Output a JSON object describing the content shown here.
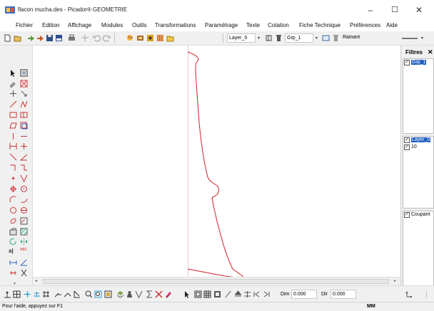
{
  "window": {
    "title": "flacon mucha.des - Picador® GEOMETRIE",
    "minimize": "–",
    "maximize": "☐",
    "close": "✕"
  },
  "menu": [
    "Fichier",
    "Edition",
    "Affichage",
    "Modules",
    "Outils",
    "Transformations",
    "Paramétrage",
    "Texte",
    "Cotation",
    "Fiche Technique",
    "Préférences",
    "Aide"
  ],
  "toolbar": {
    "layer_value": "Layer_0",
    "group_value": "Grp_1",
    "style_value": "Rainant",
    "dropdown_arrow": "▾"
  },
  "filters_panel": {
    "title": "Filtres",
    "close": "✕",
    "groups": [
      {
        "label": "Grp_1",
        "checked": true,
        "selected": true
      }
    ],
    "layers": [
      {
        "label": "Layer_0",
        "checked": true,
        "selected": true
      },
      {
        "label": "10",
        "checked": true,
        "selected": false
      }
    ],
    "types": [
      {
        "label": "Coupant",
        "checked": true,
        "selected": false
      }
    ],
    "check_mark": "✓"
  },
  "bottom_toolbar": {
    "dim_label": "Dim",
    "dim_value": "0.000",
    "dir_label": "Dir",
    "dir_value": "0.000"
  },
  "status": {
    "help": "Pour l'aide, appuyez sur F1",
    "unit": "MM"
  },
  "colors": {
    "profile": "#d0202a",
    "selection": "#1f5fbf"
  }
}
